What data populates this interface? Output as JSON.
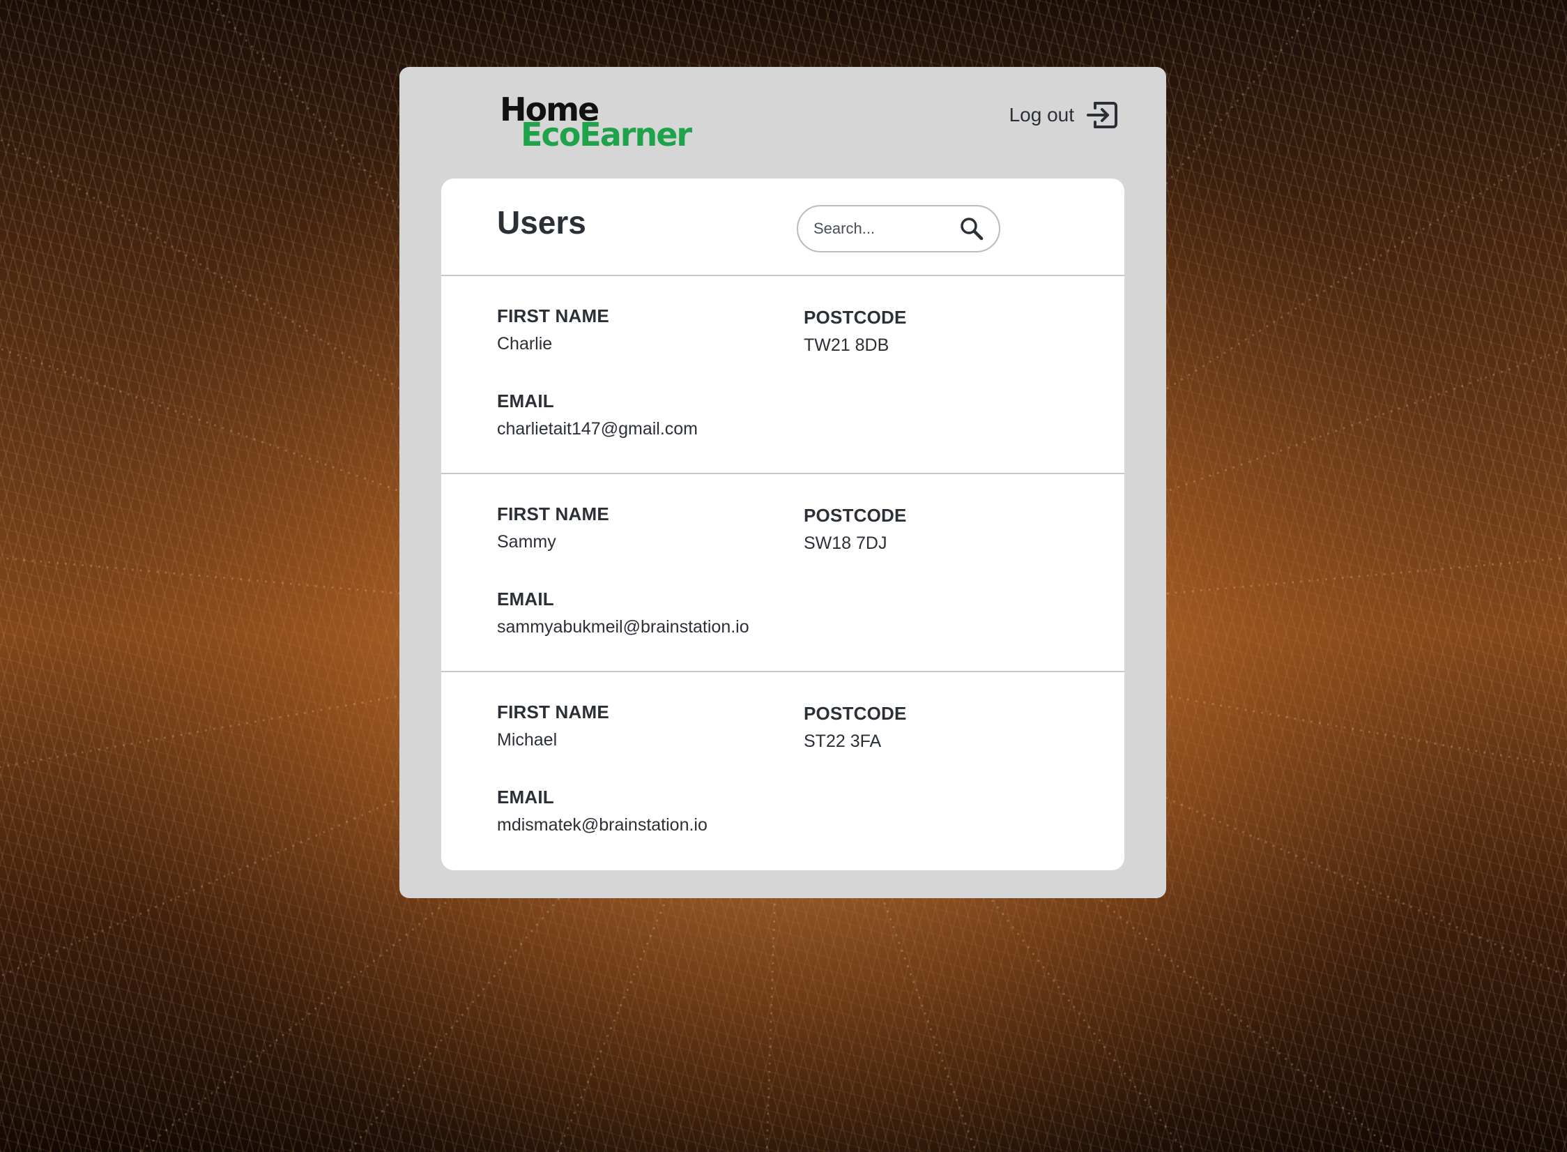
{
  "brand": {
    "line1": "Home",
    "line2": "EcoEarner",
    "accent_color": "#1fa34a"
  },
  "header": {
    "logout_label": "Log out",
    "logout_icon": "logout-icon"
  },
  "users_panel": {
    "title": "Users",
    "search": {
      "placeholder": "Search...",
      "icon": "search-icon"
    },
    "field_labels": {
      "first_name": "FIRST NAME",
      "postcode": "POSTCODE",
      "email": "EMAIL"
    },
    "users": [
      {
        "first_name": "Charlie",
        "postcode": "TW21 8DB",
        "email": "charlietait147@gmail.com"
      },
      {
        "first_name": "Sammy",
        "postcode": "SW18 7DJ",
        "email": "sammyabukmeil@brainstation.io"
      },
      {
        "first_name": "Michael",
        "postcode": "ST22 3FA",
        "email": "mdismatek@brainstation.io"
      }
    ]
  }
}
